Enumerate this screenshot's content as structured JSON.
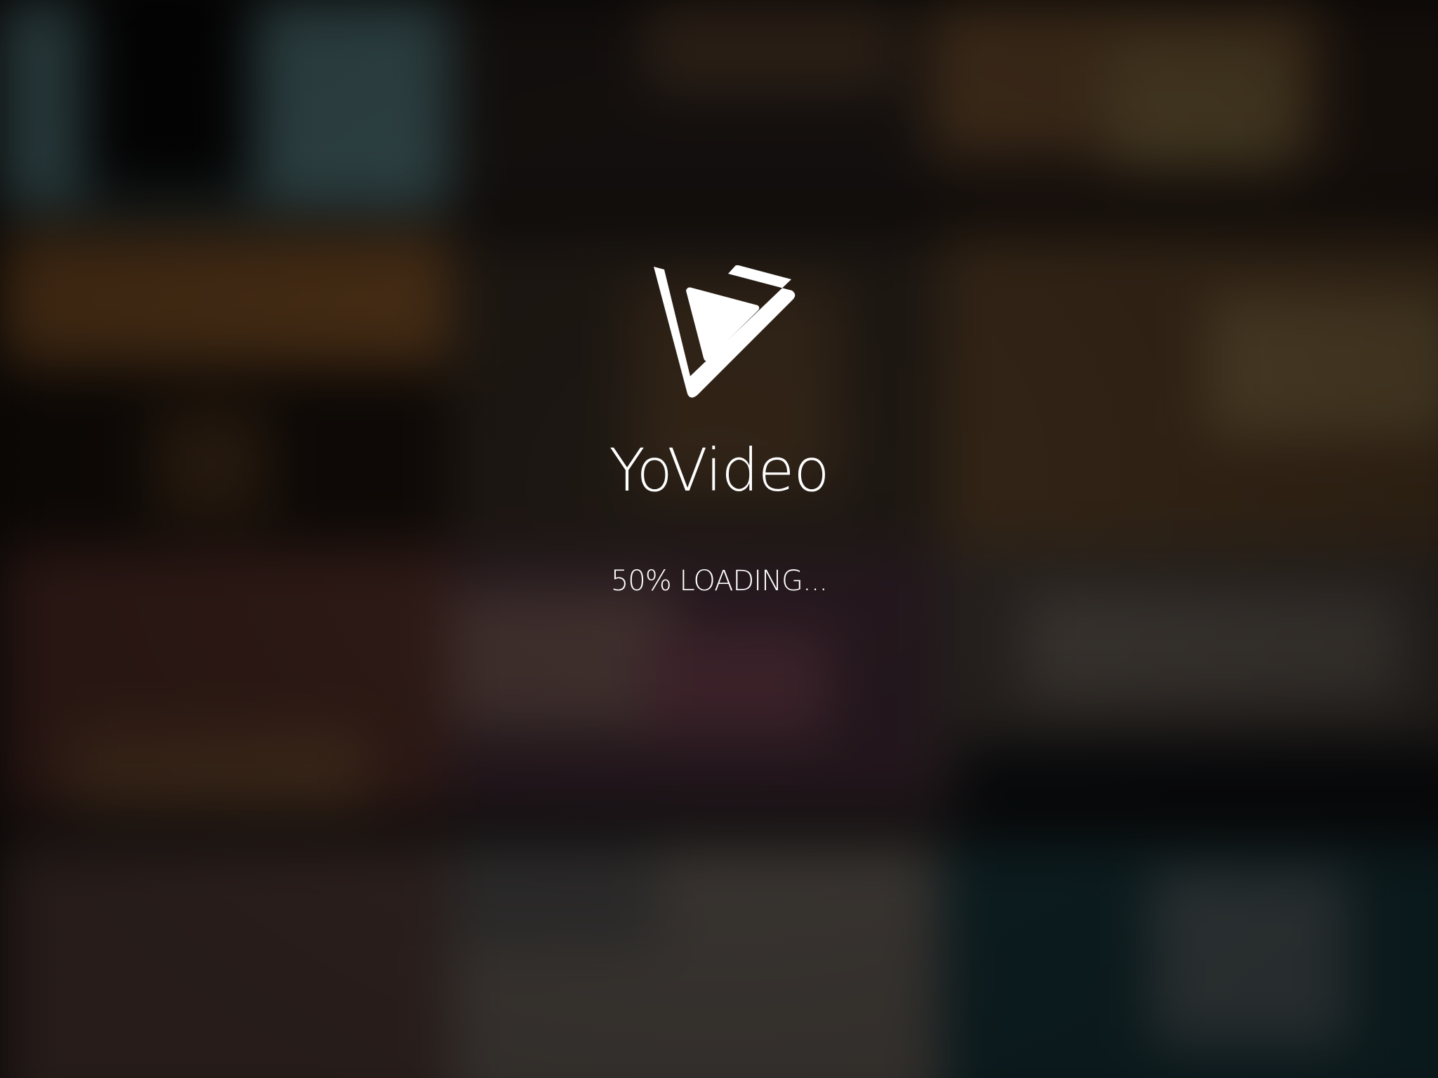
{
  "app": {
    "brand_name": "YoVideo",
    "logo_icon": "play-triangle-logo-icon"
  },
  "loading": {
    "progress_percent": 50,
    "text": "50% LOADING..."
  },
  "colors": {
    "text": "#ffffff",
    "logo": "#ffffff",
    "background": "#0b0908"
  }
}
